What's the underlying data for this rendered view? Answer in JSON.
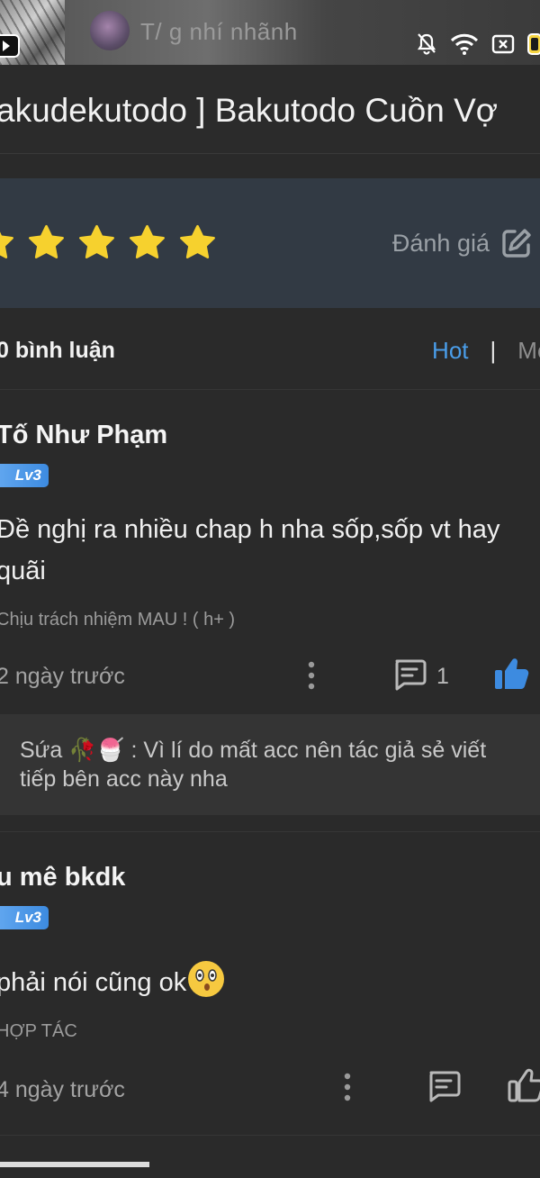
{
  "status_bar": {
    "background_name": "T/ g nhí nhãnh",
    "icons": [
      "youtube-icon",
      "bell-off-icon",
      "wifi-icon",
      "sim-icon",
      "battery-icon"
    ]
  },
  "header": {
    "title": "akudekutodo ] Bakutodo Cuồn Vợ"
  },
  "rating": {
    "stars": 5,
    "button_label": "Đánh giá",
    "star_color": "#f6d12e"
  },
  "comments": {
    "count_label": "0 bình luận",
    "sort": {
      "hot": "Hot",
      "separator": "|",
      "new": "Mớ"
    },
    "items": [
      {
        "user": "Tố Như Phạm",
        "level": "Lv3",
        "body": "Đề nghị ra nhiều chap h nha sốp,sốp vt hay quãi",
        "signature": "Chịu trách nhiệm MAU ! ( h+ )",
        "time": "2 ngày trước",
        "reply_count": "1",
        "liked": true,
        "reply": {
          "author": "Sứa",
          "emoji": "🥀🍧",
          "text": ": Vì lí do mất acc nên tác giả sẻ viết tiếp bên acc này nha"
        }
      },
      {
        "user": "u mê bkdk",
        "level": "Lv3",
        "body": "phải nói cũng ok",
        "signature": "HỢP TÁC",
        "time": "4 ngày trước",
        "liked": false
      }
    ]
  },
  "colors": {
    "accent": "#4a9eea",
    "badge": "#4a98ea",
    "background": "#2a2a2a",
    "rating_band": "#323a44"
  }
}
